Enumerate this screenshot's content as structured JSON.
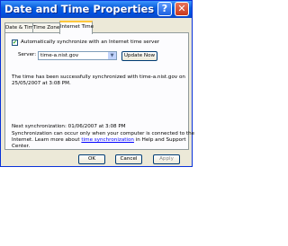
{
  "window": {
    "title": "Date and Time Properties",
    "help_label": "?",
    "close_label": "✕"
  },
  "tabs": [
    {
      "label": "Date & Time",
      "active": false
    },
    {
      "label": "Time Zone",
      "active": false
    },
    {
      "label": "Internet Time",
      "active": true
    }
  ],
  "sync": {
    "checkbox_label": "Automatically synchronize with an Internet time server",
    "checked": true,
    "server_label": "Server:",
    "server_value": "time-a.nist.gov",
    "update_button": "Update Now",
    "status_line1": "The time has been successfully synchronized with time-a.nist.gov on",
    "status_line2": "25/05/2007 at 3:08 PM.",
    "next_sync": "Next synchronization: 01/06/2007 at 3:08 PM",
    "info_line1": "Synchronization can occur only when your computer is connected to the",
    "info_line2_prefix": "Internet.  Learn more about ",
    "info_link": "time synchronization",
    "info_line2_suffix": " in Help and Support",
    "info_line3": "Center."
  },
  "buttons": {
    "ok": "OK",
    "cancel": "Cancel",
    "apply": "Apply"
  },
  "colors": {
    "titlebar": "#0054e3",
    "close": "#c7381c",
    "link": "#0000ff"
  }
}
